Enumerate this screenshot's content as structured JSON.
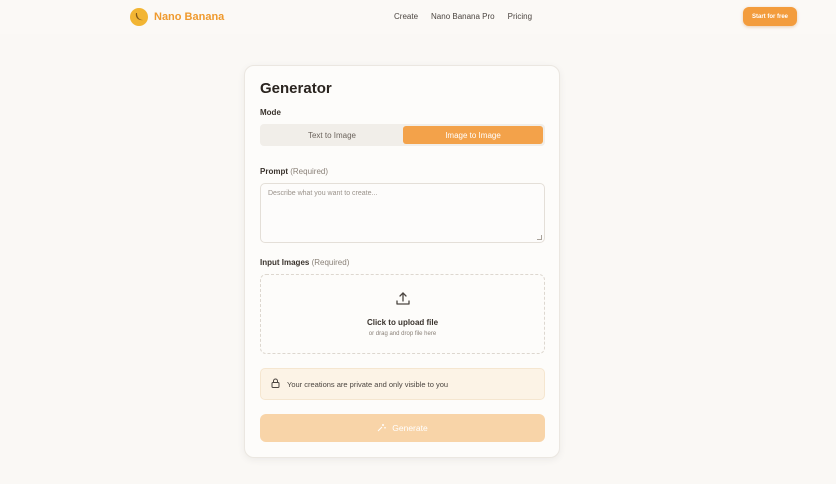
{
  "nav": {
    "brand": "Nano Banana",
    "links": [
      "Create",
      "Nano Banana Pro",
      "Pricing"
    ],
    "cta": "Start for free"
  },
  "generator": {
    "title": "Generator",
    "mode_label": "Mode",
    "modes": [
      "Text to Image",
      "Image to Image"
    ],
    "selected_mode": "Image to Image",
    "prompt_label": "Prompt",
    "prompt_required": "(Required)",
    "prompt_placeholder": "Describe what you want to create...",
    "prompt_value": "",
    "images_label": "Input Images",
    "images_required": "(Required)",
    "upload_title": "Click to upload file",
    "upload_sub": "or drag and drop file here",
    "privacy_text": "Your creations are private and only visible to you",
    "generate_label": "Generate"
  },
  "colors": {
    "accent": "#f39c3c",
    "brand_text": "#ef9a2e",
    "generate_disabled": "#f8d4a8"
  },
  "icons": [
    "banana-logo-icon",
    "upload-icon",
    "lock-icon",
    "sparkle-icon",
    "resize-grip-icon"
  ]
}
